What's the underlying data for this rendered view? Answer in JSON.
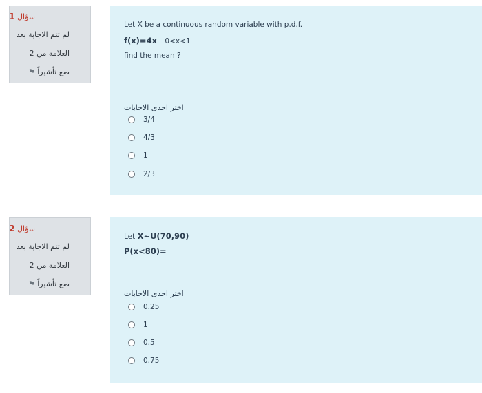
{
  "questions": [
    {
      "info": {
        "title": "سؤال",
        "number": "1",
        "status": "لم تتم الاجابة بعد",
        "mark": "العلامة من 2",
        "flag": "ضع تأشيراً"
      },
      "text": {
        "line1": "Let X be a continuous random variable with p.d.f.",
        "line2": "f(x)=4x",
        "line2_range": "0<x<1",
        "line3": "find the mean ?"
      },
      "prompt": "اختر احدى الاجابات",
      "options": [
        "3/4",
        "4/3",
        "1",
        "2/3"
      ]
    },
    {
      "info": {
        "title": "سؤال",
        "number": "2",
        "status": "لم تتم الاجابة بعد",
        "mark": "العلامة من 2",
        "flag": "ضع تأشيراً"
      },
      "text": {
        "line1_prefix": "Let",
        "line1_bold": "X~U(70,90)",
        "line2": "P(x<80)="
      },
      "prompt": "اختر احدى الاجابات",
      "options": [
        "0.25",
        "1",
        "0.5",
        "0.75"
      ]
    }
  ]
}
